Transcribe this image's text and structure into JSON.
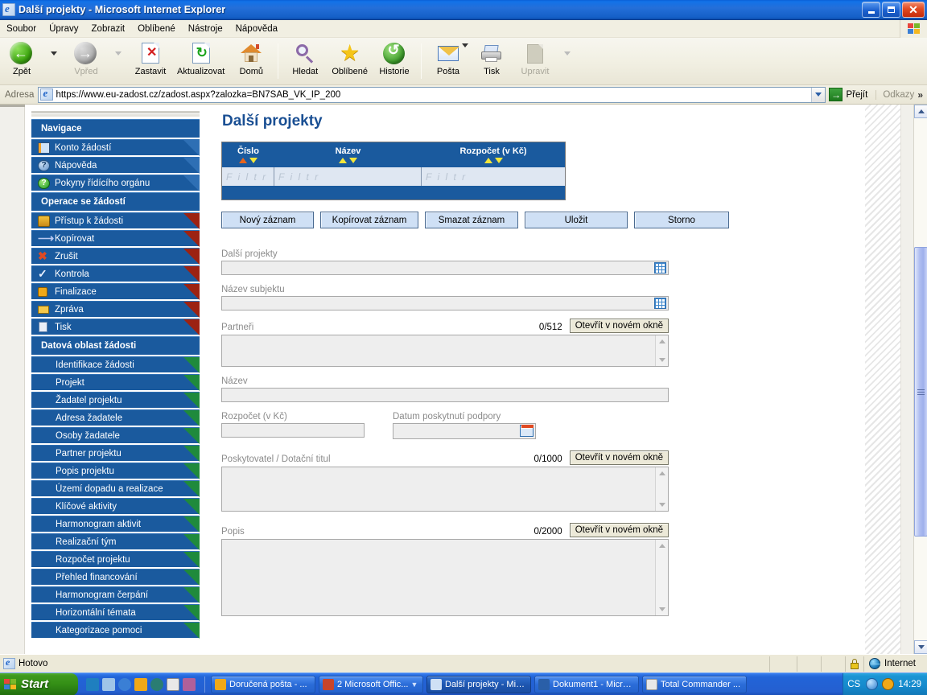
{
  "window": {
    "title": "Další projekty - Microsoft Internet Explorer",
    "icon": "ie-document-icon",
    "minimize_label": "Minimalizovat",
    "maximize_label": "Maximalizovat",
    "close_label": "Zavřít"
  },
  "menubar": {
    "items": [
      {
        "label": "Soubor",
        "name": "menu-soubor"
      },
      {
        "label": "Úpravy",
        "name": "menu-upravy"
      },
      {
        "label": "Zobrazit",
        "name": "menu-zobrazit"
      },
      {
        "label": "Oblíbené",
        "name": "menu-oblibene"
      },
      {
        "label": "Nástroje",
        "name": "menu-nastroje"
      },
      {
        "label": "Nápověda",
        "name": "menu-napoveda"
      }
    ]
  },
  "toolbar": {
    "back": "Zpět",
    "forward": "Vpřed",
    "stop": "Zastavit",
    "refresh": "Aktualizovat",
    "home": "Domů",
    "search": "Hledat",
    "favorites": "Oblíbené",
    "history": "Historie",
    "mail": "Pošta",
    "print": "Tisk",
    "edit": "Upravit"
  },
  "address_bar": {
    "label": "Adresa",
    "url": "https://www.eu-zadost.cz/zadost.aspx?zalozka=BN7SAB_VK_IP_200",
    "go_label": "Přejít",
    "links_label": "Odkazy",
    "chevron": "»"
  },
  "sidebar": {
    "groups": [
      {
        "heading": "Navigace",
        "items": [
          {
            "label": "Konto žádostí",
            "icon": "book-icon",
            "corner": "plain"
          },
          {
            "label": "Nápověda",
            "icon": "question-blue-icon",
            "corner": "plain"
          },
          {
            "label": "Pokyny řídícího orgánu",
            "icon": "question-green-icon",
            "corner": "plain"
          }
        ]
      },
      {
        "heading": "Operace se žádostí",
        "items": [
          {
            "label": "Přístup k žádosti",
            "icon": "users-icon",
            "corner": "red"
          },
          {
            "label": "Kopírovat",
            "icon": "arrow-icon",
            "corner": "red"
          },
          {
            "label": "Zrušit",
            "icon": "cancel-icon",
            "corner": "red"
          },
          {
            "label": "Kontrola",
            "icon": "check-icon",
            "corner": "red"
          },
          {
            "label": "Finalizace",
            "icon": "lock-icon",
            "corner": "red"
          },
          {
            "label": "Zpráva",
            "icon": "message-icon",
            "corner": "red"
          },
          {
            "label": "Tisk",
            "icon": "print-doc-icon",
            "corner": "red"
          }
        ]
      },
      {
        "heading": "Datová oblast žádosti",
        "items": [
          {
            "label": "Identifikace žádosti",
            "icon": "",
            "corner": "green"
          },
          {
            "label": "Projekt",
            "icon": "",
            "corner": "green"
          },
          {
            "label": "Žadatel projektu",
            "icon": "",
            "corner": "green"
          },
          {
            "label": "Adresa žadatele",
            "icon": "",
            "corner": "green"
          },
          {
            "label": "Osoby žadatele",
            "icon": "",
            "corner": "green"
          },
          {
            "label": "Partner projektu",
            "icon": "",
            "corner": "green"
          },
          {
            "label": "Popis projektu",
            "icon": "",
            "corner": "green"
          },
          {
            "label": "Území dopadu a realizace",
            "icon": "",
            "corner": "green"
          },
          {
            "label": "Klíčové aktivity",
            "icon": "",
            "corner": "green"
          },
          {
            "label": "Harmonogram aktivit",
            "icon": "",
            "corner": "green"
          },
          {
            "label": "Realizační tým",
            "icon": "",
            "corner": "green"
          },
          {
            "label": "Rozpočet projektu",
            "icon": "",
            "corner": "green"
          },
          {
            "label": "Přehled financování",
            "icon": "",
            "corner": "green"
          },
          {
            "label": "Harmonogram čerpání",
            "icon": "",
            "corner": "green"
          },
          {
            "label": "Horizontální témata",
            "icon": "",
            "corner": "green"
          },
          {
            "label": "Kategorizace pomoci",
            "icon": "",
            "corner": "green"
          }
        ]
      }
    ]
  },
  "content": {
    "page_title": "Další projekty",
    "grid": {
      "columns": [
        {
          "label": "Číslo",
          "sort_active": "asc",
          "filter_placeholder": "F i l t r"
        },
        {
          "label": "Název",
          "sort_active": "none",
          "filter_placeholder": "F i l t r"
        },
        {
          "label": "Rozpočet (v Kč)",
          "sort_active": "none",
          "filter_placeholder": "F i l t r"
        }
      ],
      "rows": []
    },
    "buttons": [
      {
        "label": "Nový záznam",
        "name": "new-record-button"
      },
      {
        "label": "Kopírovat záznam",
        "name": "copy-record-button"
      },
      {
        "label": "Smazat záznam",
        "name": "delete-record-button"
      },
      {
        "label": "Uložit",
        "name": "save-button"
      },
      {
        "label": "Storno",
        "name": "cancel-button"
      }
    ],
    "fields": {
      "dalsi_projekty": {
        "label": "Další projekty",
        "value": ""
      },
      "nazev_subjektu": {
        "label": "Název subjektu",
        "value": ""
      },
      "partneri": {
        "label": "Partneři",
        "counter": "0/512",
        "open_label": "Otevřít v novém okně",
        "value": ""
      },
      "nazev": {
        "label": "Název",
        "value": ""
      },
      "rozpocet": {
        "label": "Rozpočet (v Kč)",
        "value": ""
      },
      "datum": {
        "label": "Datum poskytnutí podpory",
        "value": ""
      },
      "poskytovatel": {
        "label": "Poskytovatel / Dotační titul",
        "counter": "0/1000",
        "open_label": "Otevřít v novém okně",
        "value": ""
      },
      "popis": {
        "label": "Popis",
        "counter": "0/2000",
        "open_label": "Otevřít v novém okně",
        "value": ""
      }
    }
  },
  "statusbar": {
    "status": "Hotovo",
    "zone": "Internet",
    "lock_icon": "padlock-icon",
    "globe_icon": "globe-icon"
  },
  "taskbar": {
    "start_label": "Start",
    "tasks": [
      {
        "label": "Doručená pošta - ...",
        "icon": "outlook-icon",
        "color": "#f0a818"
      },
      {
        "label": "2 Microsoft Offic...",
        "icon": "office-icon",
        "color": "#c8442a"
      },
      {
        "label": "Další projekty - Mic...",
        "icon": "ie-icon",
        "color": "#3a7fd5",
        "active": true
      },
      {
        "label": "Dokument1 - Micro...",
        "icon": "word-icon",
        "color": "#2a5fa8"
      },
      {
        "label": "Total Commander ...",
        "icon": "tc-icon",
        "color": "#c03020"
      }
    ],
    "language": "CS",
    "clock": "14:29"
  },
  "colors": {
    "title_blue": "#1560c8",
    "sidebar_blue": "#1a5a9e",
    "heading_blue": "#1a4f93",
    "button_blue": "#cfe0f5",
    "sort_yellow": "#f2e63a",
    "sort_active_orange": "#e8641c",
    "corner_green": "#1f8a3c",
    "corner_red": "#9c2212"
  }
}
